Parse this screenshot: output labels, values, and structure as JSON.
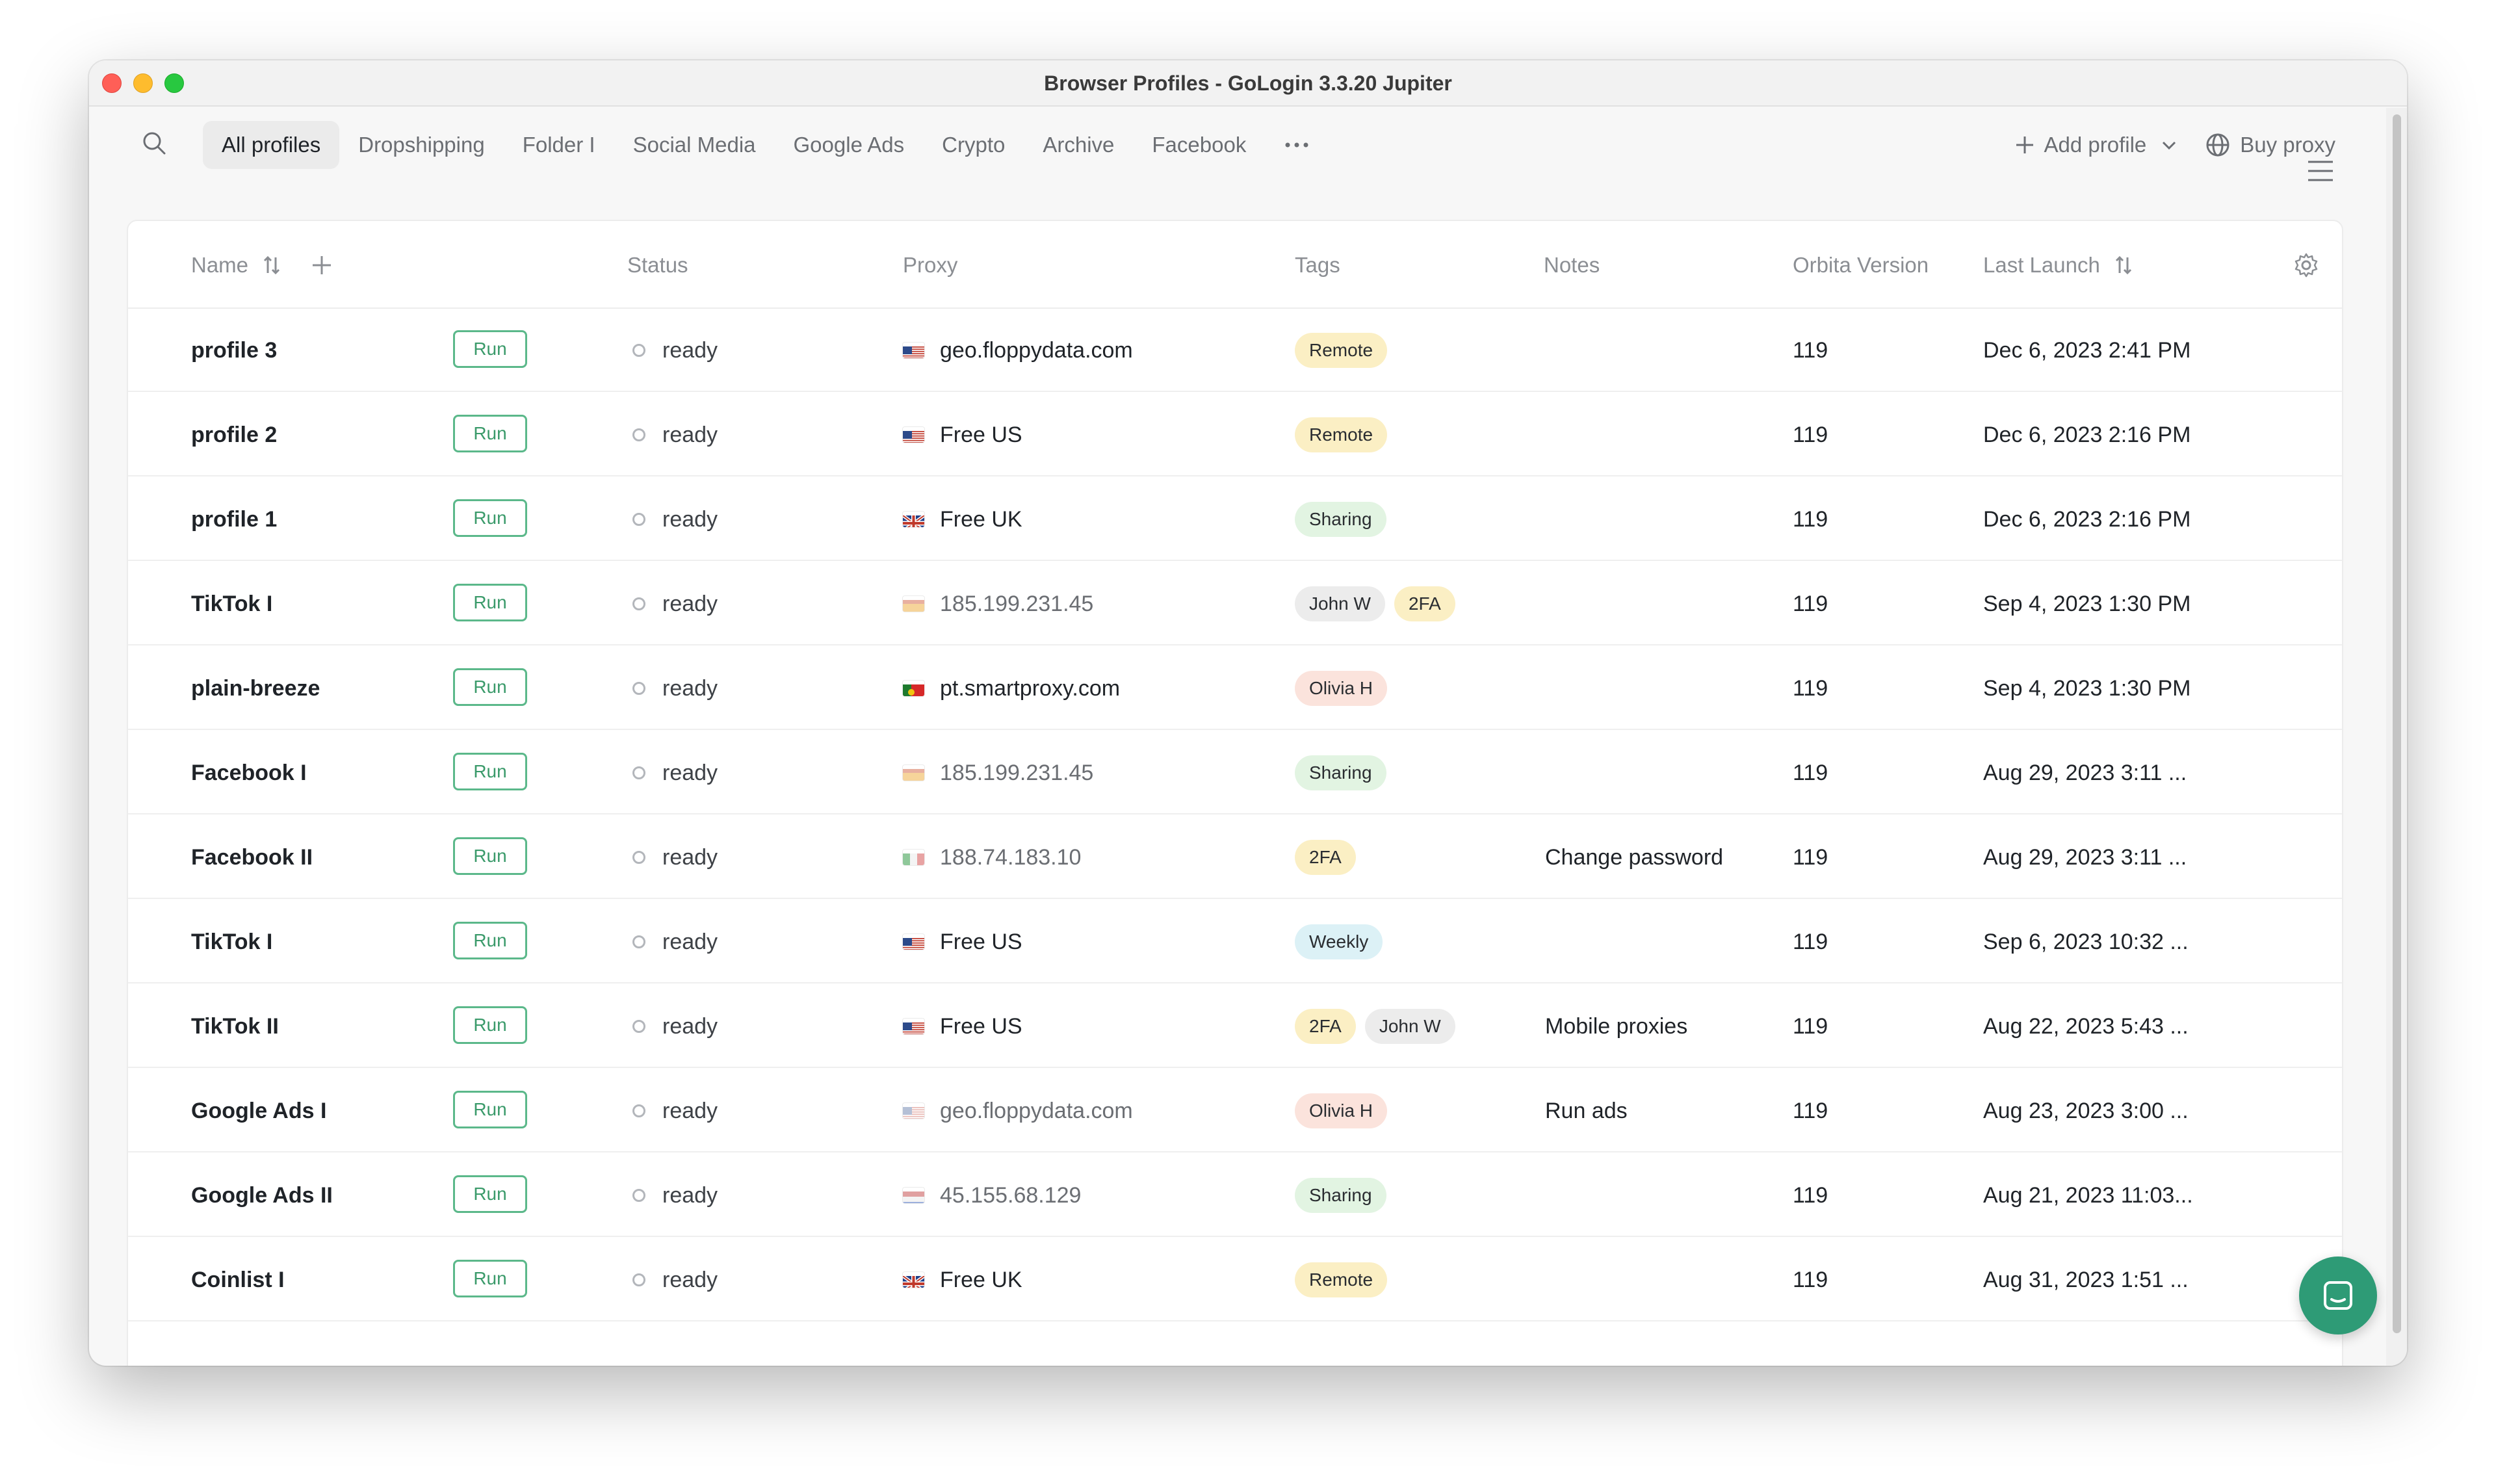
{
  "window": {
    "title": "Browser Profiles - GoLogin 3.3.20 Jupiter"
  },
  "toolbar": {
    "tabs": [
      {
        "label": "All profiles",
        "active": true
      },
      {
        "label": "Dropshipping"
      },
      {
        "label": "Folder I"
      },
      {
        "label": "Social Media"
      },
      {
        "label": "Google Ads"
      },
      {
        "label": "Crypto"
      },
      {
        "label": "Archive"
      },
      {
        "label": "Facebook"
      }
    ],
    "more_icon": "more-horizontal-icon",
    "add_profile": "Add profile",
    "buy_proxy": "Buy proxy"
  },
  "table": {
    "columns": {
      "name": "Name",
      "status": "Status",
      "proxy": "Proxy",
      "tags": "Tags",
      "notes": "Notes",
      "version": "Orbita Version",
      "launch": "Last Launch"
    },
    "run_label": "Run",
    "rows": [
      {
        "name": "profile 3",
        "status": "ready",
        "flag": "us",
        "proxy": "geo.floppydata.com",
        "proxy_muted": false,
        "tags": [
          "Remote"
        ],
        "notes": "",
        "version": "119",
        "launch": "Dec 6, 2023 2:41 PM"
      },
      {
        "name": "profile 2",
        "status": "ready",
        "flag": "us",
        "proxy": "Free US",
        "proxy_muted": false,
        "tags": [
          "Remote"
        ],
        "notes": "",
        "version": "119",
        "launch": "Dec 6, 2023 2:16 PM"
      },
      {
        "name": "profile 1",
        "status": "ready",
        "flag": "uk",
        "proxy": "Free UK",
        "proxy_muted": false,
        "tags": [
          "Sharing"
        ],
        "notes": "",
        "version": "119",
        "launch": "Dec 6, 2023 2:16 PM"
      },
      {
        "name": "TikTok I",
        "status": "ready",
        "flag": "es",
        "proxy": "185.199.231.45",
        "proxy_muted": true,
        "tags": [
          "John W",
          "2FA"
        ],
        "notes": "",
        "version": "119",
        "launch": "Sep 4, 2023 1:30 PM"
      },
      {
        "name": "plain-breeze",
        "status": "ready",
        "flag": "pt",
        "proxy": "pt.smartproxy.com",
        "proxy_muted": false,
        "tags": [
          "Olivia H"
        ],
        "notes": "",
        "version": "119",
        "launch": "Sep 4, 2023 1:30 PM"
      },
      {
        "name": "Facebook I",
        "status": "ready",
        "flag": "es",
        "proxy": "185.199.231.45",
        "proxy_muted": true,
        "tags": [
          "Sharing"
        ],
        "notes": "",
        "version": "119",
        "launch": "Aug 29, 2023 3:11 ..."
      },
      {
        "name": "Facebook II",
        "status": "ready",
        "flag": "it",
        "proxy": "188.74.183.10",
        "proxy_muted": true,
        "tags": [
          "2FA"
        ],
        "notes": "Change password",
        "version": "119",
        "launch": "Aug 29, 2023 3:11 ..."
      },
      {
        "name": "TikTok I",
        "status": "ready",
        "flag": "us",
        "proxy": "Free US",
        "proxy_muted": false,
        "tags": [
          "Weekly"
        ],
        "notes": "",
        "version": "119",
        "launch": "Sep 6, 2023 10:32 ..."
      },
      {
        "name": "TikTok II",
        "status": "ready",
        "flag": "us",
        "proxy": "Free US",
        "proxy_muted": false,
        "tags": [
          "2FA",
          "John W"
        ],
        "notes": "Mobile proxies",
        "version": "119",
        "launch": "Aug 22, 2023 5:43 ..."
      },
      {
        "name": "Google Ads I",
        "status": "ready",
        "flag": "us-faded",
        "proxy": "geo.floppydata.com",
        "proxy_muted": true,
        "tags": [
          "Olivia H"
        ],
        "notes": "Run ads",
        "version": "119",
        "launch": "Aug 23, 2023 3:00 ..."
      },
      {
        "name": "Google Ads II",
        "status": "ready",
        "flag": "nl",
        "proxy": "45.155.68.129",
        "proxy_muted": true,
        "tags": [
          "Sharing"
        ],
        "notes": "",
        "version": "119",
        "launch": "Aug 21, 2023 11:03..."
      },
      {
        "name": "Coinlist I",
        "status": "ready",
        "flag": "uk",
        "proxy": "Free UK",
        "proxy_muted": false,
        "tags": [
          "Remote"
        ],
        "notes": "",
        "version": "119",
        "launch": "Aug 31, 2023 1:51 ..."
      }
    ]
  },
  "tag_colors": {
    "Remote": "#fbefc4",
    "Sharing": "#e2f4e2",
    "John W": "#ececec",
    "2FA": "#fbefc4",
    "Olivia H": "#fbe3dc",
    "Weekly": "#dcf1f6"
  },
  "accent": "#2e9b76"
}
